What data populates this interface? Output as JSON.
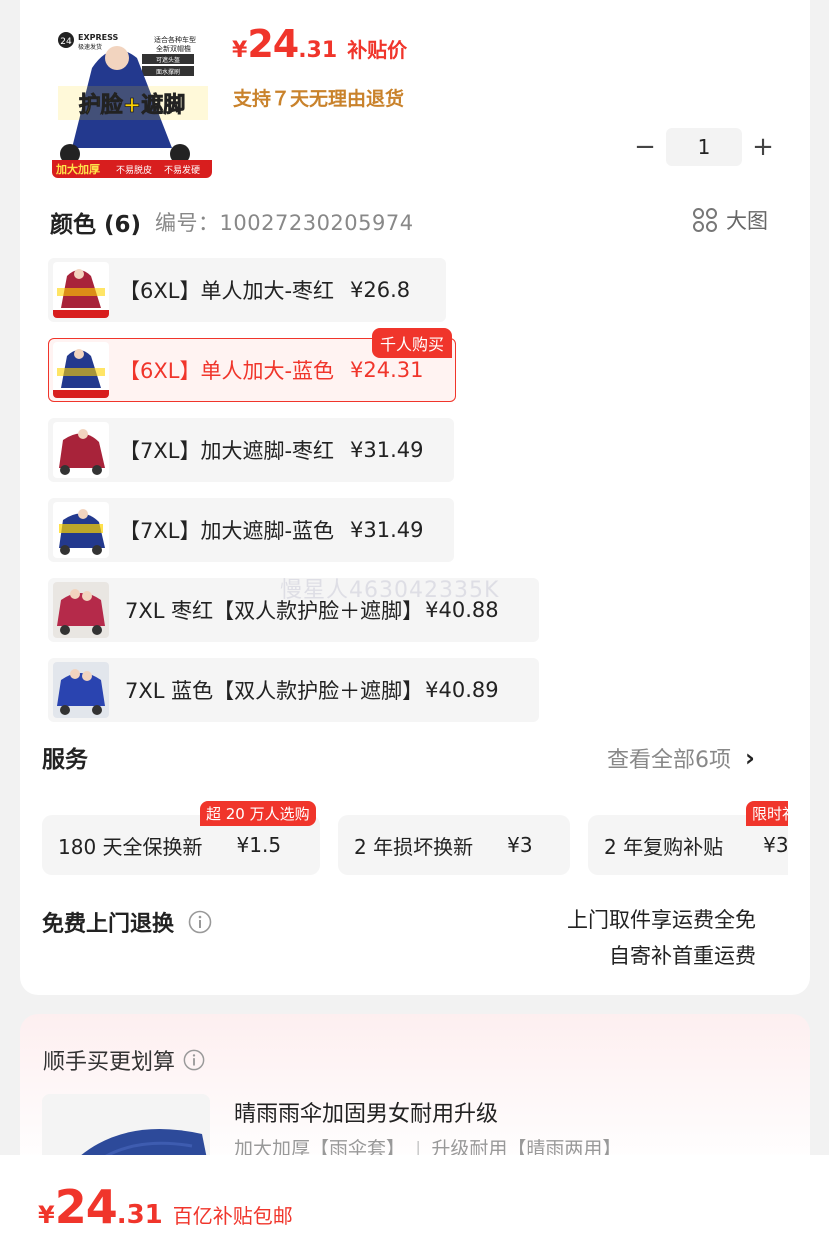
{
  "product": {
    "price_symbol": "¥",
    "price_int": "24",
    "price_dec": ".31",
    "price_tag": "补贴价",
    "return_note": "支持７天无理由退货",
    "quantity": "1",
    "qty_minus": "−",
    "qty_plus": "+",
    "thumb_text": {
      "brand": "EXPRESS",
      "brand_sub": "极速发货",
      "badge": "24",
      "car_types": "适合各种车型",
      "visor": "全新双帽檐",
      "tag1": "可遮头盔",
      "tag2": "面水撑刷",
      "main": "护脸+遮脚",
      "bottom_a": "加大加厚",
      "bottom_b": "不易脱皮",
      "bottom_c": "不易发硬"
    }
  },
  "color_section": {
    "title": "颜色 (6)",
    "code": "编号：10027230205974",
    "big_image": "大图"
  },
  "variants": [
    {
      "label": "【6XL】单人加大-枣红",
      "price": "¥26.8"
    },
    {
      "label": "【6XL】单人加大-蓝色",
      "price": "¥24.31"
    },
    {
      "label": "【7XL】加大遮脚-枣红",
      "price": "¥31.49"
    },
    {
      "label": "【7XL】加大遮脚-蓝色",
      "price": "¥31.49"
    },
    {
      "label": "7XL 枣红【双人款护脸＋遮脚】",
      "price": "¥40.88"
    },
    {
      "label": "7XL 蓝色【双人款护脸＋遮脚】",
      "price": "¥40.89"
    }
  ],
  "hot_badge": "千人购买",
  "watermark": "慢星人463042335K",
  "services": {
    "title": "服务",
    "view_all": "查看全部6项",
    "items": [
      {
        "name": "180 天全保换新",
        "price": "¥1.5",
        "badge": "超 20 万人选购"
      },
      {
        "name": "2 年损坏换新",
        "price": "¥3",
        "badge": ""
      },
      {
        "name": "2 年复购补贴",
        "price": "¥3",
        "badge": "限时补"
      }
    ]
  },
  "free_return": {
    "title": "免费上门退换",
    "line1": "上门取件享运费全免",
    "line2": "自寄补首重运费"
  },
  "bundle": {
    "title": "顺手买更划算",
    "item_name": "晴雨雨伞加固男女耐用升级",
    "item_sub1": "加大加厚【雨伞套】",
    "item_sep": "|",
    "item_sub2": "升级耐用【晴雨两用】"
  },
  "bottom": {
    "price_symbol": "¥",
    "price_int": "24",
    "price_dec": ".31",
    "price_tag": "百亿补贴包邮"
  },
  "colors": {
    "accent_red": "#f0352b",
    "gold": "#c9822b",
    "maroon": "#a8233a",
    "navy": "#23398e"
  }
}
